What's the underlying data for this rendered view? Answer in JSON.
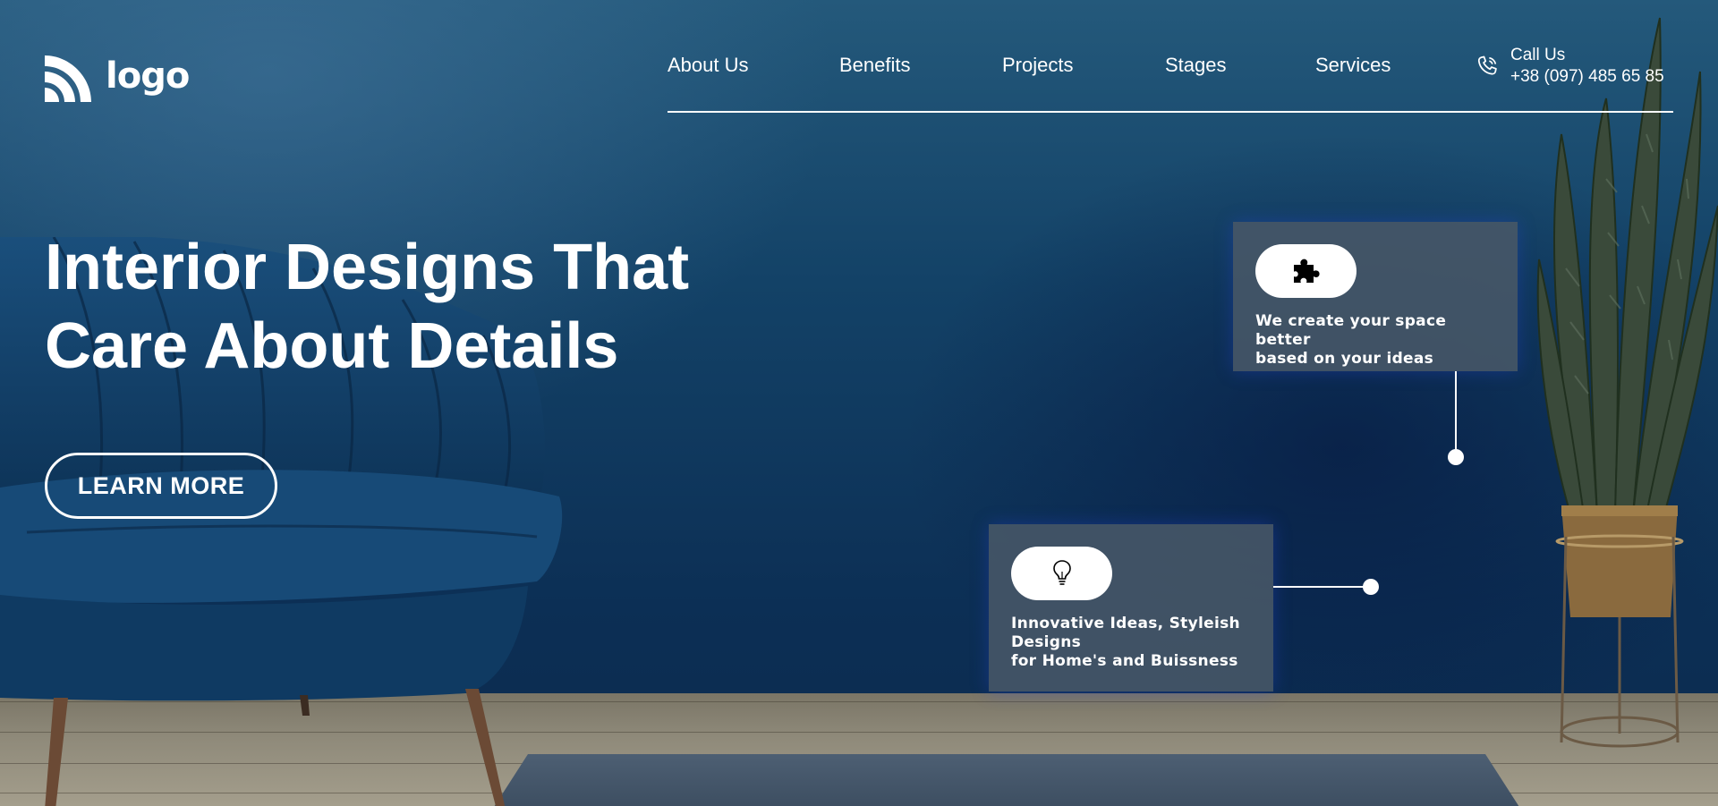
{
  "header": {
    "logo_text": "logo",
    "nav": [
      "About Us",
      "Benefits",
      "Projects",
      "Stages",
      "Services"
    ],
    "call_label": "Call Us",
    "call_phone": "+38 (097) 485 65 85"
  },
  "hero": {
    "title_line1": "Interior Designs That",
    "title_line2": "Care About Details",
    "cta_label": "LEARN MORE"
  },
  "cards": [
    {
      "icon": "puzzle-icon",
      "text": "We create your space better\nbased on your ideas"
    },
    {
      "icon": "lightbulb-icon",
      "text": "Innovative Ideas, Styleish\nDesigns\nfor Home's and Buissness"
    }
  ],
  "colors": {
    "wall": "#134267",
    "card_bg": "#485868",
    "text": "#ffffff"
  }
}
